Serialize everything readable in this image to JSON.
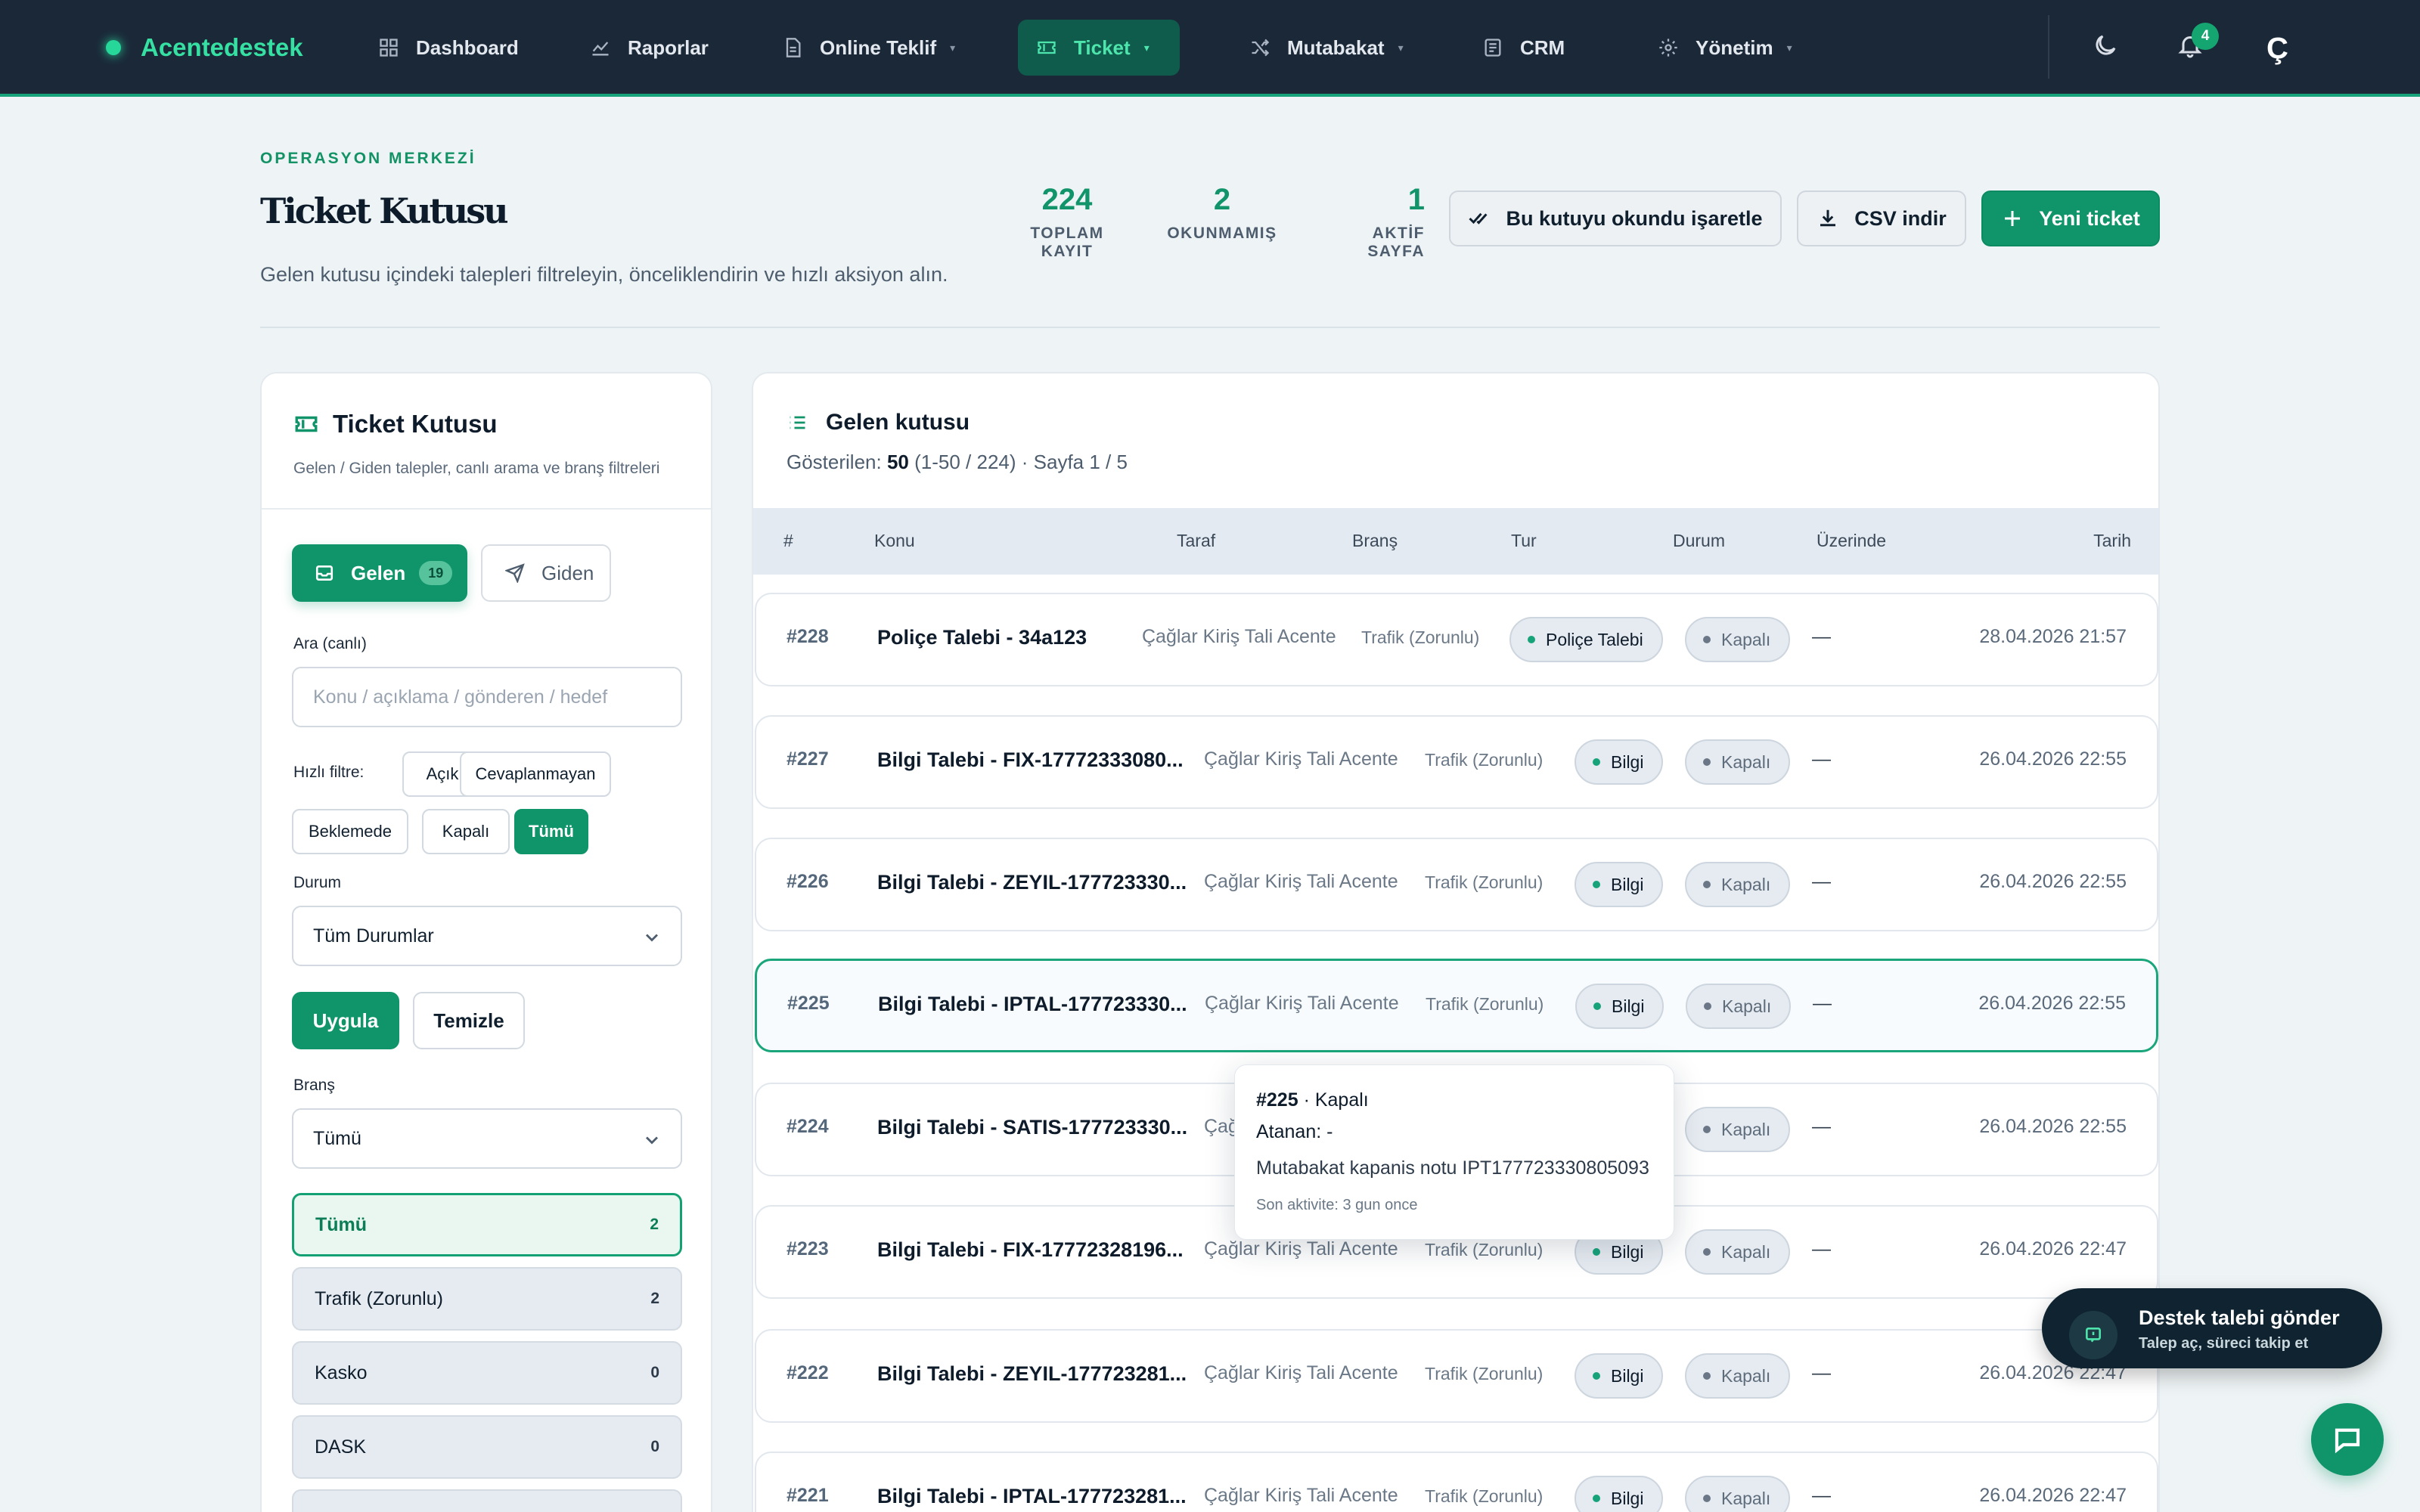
{
  "nav": {
    "brand": "Acentedestek",
    "items": [
      {
        "label": "Dashboard"
      },
      {
        "label": "Raporlar"
      },
      {
        "label": "Online Teklif"
      },
      {
        "label": "Ticket"
      },
      {
        "label": "Mutabakat"
      },
      {
        "label": "CRM"
      },
      {
        "label": "Yönetim"
      }
    ],
    "notification_count": "4",
    "avatar_letter": "Ç"
  },
  "header": {
    "eyebrow": "OPERASYON MERKEZİ",
    "title": "Ticket Kutusu",
    "description": "Gelen kutusu içindeki talepleri filtreleyin, önceliklendirin ve hızlı aksiyon alın.",
    "stats": [
      {
        "value": "224",
        "label": "TOPLAM KAYIT"
      },
      {
        "value": "2",
        "label": "OKUNMAMIŞ"
      },
      {
        "value": "1",
        "label": "AKTİF SAYFA"
      }
    ],
    "mark_read_label": "Bu kutuyu okundu işaretle",
    "csv_label": "CSV indir",
    "new_ticket_label": "Yeni ticket"
  },
  "filters": {
    "title": "Ticket Kutusu",
    "subtitle": "Gelen / Giden talepler, canlı arama ve branş filtreleri",
    "tab_incoming": "Gelen",
    "tab_incoming_count": "19",
    "tab_outgoing": "Giden",
    "search_label": "Ara (canlı)",
    "search_placeholder": "Konu / açıklama / gönderen / hedef",
    "quick_label": "Hızlı filtre:",
    "quick": [
      "Açık",
      "Cevaplanmayan",
      "Beklemede",
      "Kapalı",
      "Tümü"
    ],
    "quick_active": "Tümü",
    "status_label": "Durum",
    "status_value": "Tüm Durumlar",
    "apply_label": "Uygula",
    "clear_label": "Temizle",
    "branch_label": "Branş",
    "branch_value": "Tümü",
    "branches": [
      {
        "name": "Tümü",
        "count": "2"
      },
      {
        "name": "Trafik (Zorunlu)",
        "count": "2"
      },
      {
        "name": "Kasko",
        "count": "0"
      },
      {
        "name": "DASK",
        "count": "0"
      }
    ]
  },
  "inbox": {
    "title": "Gelen kutusu",
    "shown_prefix": "Gösterilen:",
    "shown_count": "50",
    "shown_suffix": "(1-50 / 224) · Sayfa 1 / 5",
    "columns": [
      "#",
      "Konu",
      "Taraf",
      "Branş",
      "Tur",
      "Durum",
      "Üzerinde",
      "Tarih"
    ],
    "rows": [
      {
        "id": "#228",
        "subject": "Poliçe Talebi - 34a123",
        "party": "Çağlar Kiriş Tali Acente",
        "branch": "Trafik (Zorunlu)",
        "type": "Poliçe Talebi",
        "status": "Kapalı",
        "owner": "—",
        "date": "28.04.2026 21:57"
      },
      {
        "id": "#227",
        "subject": "Bilgi Talebi - FIX-17772333080...",
        "party": "Çağlar Kiriş Tali Acente",
        "branch": "Trafik (Zorunlu)",
        "type": "Bilgi",
        "status": "Kapalı",
        "owner": "—",
        "date": "26.04.2026 22:55"
      },
      {
        "id": "#226",
        "subject": "Bilgi Talebi - ZEYIL-177723330...",
        "party": "Çağlar Kiriş Tali Acente",
        "branch": "Trafik (Zorunlu)",
        "type": "Bilgi",
        "status": "Kapalı",
        "owner": "—",
        "date": "26.04.2026 22:55"
      },
      {
        "id": "#225",
        "subject": "Bilgi Talebi - IPTAL-177723330...",
        "party": "Çağlar Kiriş Tali Acente",
        "branch": "Trafik (Zorunlu)",
        "type": "Bilgi",
        "status": "Kapalı",
        "owner": "—",
        "date": "26.04.2026 22:55"
      },
      {
        "id": "#224",
        "subject": "Bilgi Talebi - SATIS-177723330...",
        "party": "Çağlar Kiriş Tali Acente",
        "branch": "Trafik (Zorunlu)",
        "type": "Bilgi",
        "status": "Kapalı",
        "owner": "—",
        "date": "26.04.2026 22:55"
      },
      {
        "id": "#223",
        "subject": "Bilgi Talebi - FIX-17772328196...",
        "party": "Çağlar Kiriş Tali Acente",
        "branch": "Trafik (Zorunlu)",
        "type": "Bilgi",
        "status": "Kapalı",
        "owner": "—",
        "date": "26.04.2026 22:47"
      },
      {
        "id": "#222",
        "subject": "Bilgi Talebi - ZEYIL-177723281...",
        "party": "Çağlar Kiriş Tali Acente",
        "branch": "Trafik (Zorunlu)",
        "type": "Bilgi",
        "status": "Kapalı",
        "owner": "—",
        "date": "26.04.2026 22:47"
      },
      {
        "id": "#221",
        "subject": "Bilgi Talebi - IPTAL-177723281...",
        "party": "Çağlar Kiriş Tali Acente",
        "branch": "Trafik (Zorunlu)",
        "type": "Bilgi",
        "status": "Kapalı",
        "owner": "—",
        "date": "26.04.2026 22:47"
      }
    ]
  },
  "tooltip": {
    "id": "#225",
    "status": "· Kapalı",
    "assignee": "Atanan: -",
    "note": "Mutabakat kapanis notu IPT177723330805093",
    "activity": "Son aktivite: 3 gun once"
  },
  "support": {
    "title": "Destek talebi gönder",
    "subtitle": "Talep aç, süreci takip et"
  },
  "colors": {
    "nav_bg": "#1b2838",
    "accent": "#10946a",
    "brand": "#36dfa2",
    "page_bg": "#eef4f5"
  }
}
